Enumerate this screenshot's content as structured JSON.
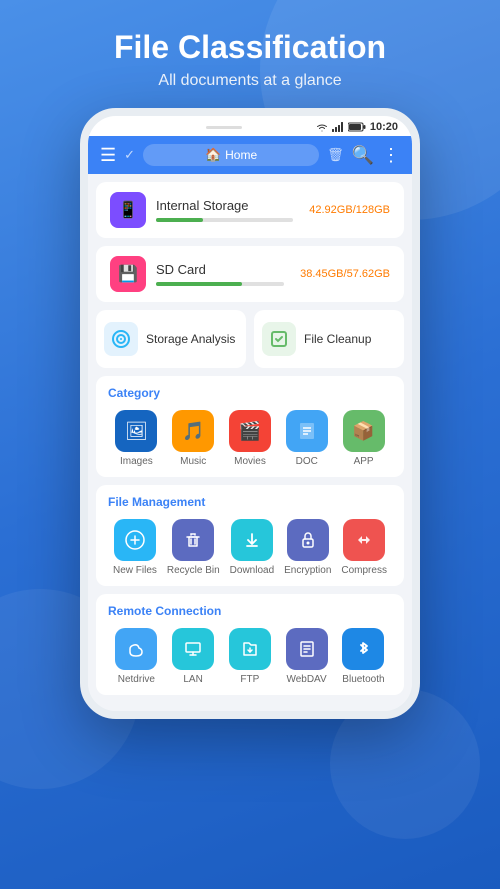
{
  "header": {
    "title": "File Classification",
    "subtitle": "All documents at a glance"
  },
  "status_bar": {
    "time": "10:20",
    "wifi_icon": "wifi",
    "signal_icon": "signal",
    "battery_icon": "battery"
  },
  "nav": {
    "home_label": "Home",
    "menu_icon": "☰",
    "check_icon": "✓",
    "search_icon": "🔍",
    "more_icon": "⋮",
    "home_icon": "🏠",
    "trash_icon": "🗑"
  },
  "storage": [
    {
      "name": "Internal Storage",
      "used": "42.92GB",
      "total": "128GB",
      "fill_percent": 34,
      "icon": "📱",
      "bg": "#7c4dff"
    },
    {
      "name": "SD Card",
      "used": "38.45GB",
      "total": "57.62GB",
      "fill_percent": 67,
      "icon": "💾",
      "bg": "#ff4081"
    }
  ],
  "quick_actions": [
    {
      "label": "Storage Analysis",
      "icon": "◎",
      "bg": "#e3f2fd",
      "color": "#29b6f6"
    },
    {
      "label": "File Cleanup",
      "icon": "⬜",
      "bg": "#e8f5e9",
      "color": "#66bb6a"
    }
  ],
  "category": {
    "title": "Category",
    "items": [
      {
        "label": "Images",
        "icon": "🖼",
        "bg": "#1565C0"
      },
      {
        "label": "Music",
        "icon": "🎵",
        "bg": "#FF9800"
      },
      {
        "label": "Movies",
        "icon": "🎬",
        "bg": "#F44336"
      },
      {
        "label": "DOC",
        "icon": "📄",
        "bg": "#42A5F5"
      },
      {
        "label": "APP",
        "icon": "📦",
        "bg": "#66BB6A"
      }
    ]
  },
  "file_management": {
    "title": "File Management",
    "items": [
      {
        "label": "New Files",
        "icon": "🕐",
        "bg": "#29B6F6"
      },
      {
        "label": "Recycle Bin",
        "icon": "🗑",
        "bg": "#5C6BC0"
      },
      {
        "label": "Download",
        "icon": "⬇",
        "bg": "#26C6DA"
      },
      {
        "label": "Encryption",
        "icon": "🔒",
        "bg": "#5C6BC0"
      },
      {
        "label": "Compress",
        "icon": "🔀",
        "bg": "#EF5350"
      }
    ]
  },
  "remote_connection": {
    "title": "Remote Connection",
    "items": [
      {
        "label": "Netdrive",
        "icon": "☁",
        "bg": "#42A5F5"
      },
      {
        "label": "LAN",
        "icon": "🖥",
        "bg": "#26C6DA"
      },
      {
        "label": "FTP",
        "icon": "📂",
        "bg": "#26C6DA"
      },
      {
        "label": "WebDAV",
        "icon": "📋",
        "bg": "#5C6BC0"
      },
      {
        "label": "Bluetooth",
        "icon": "🔵",
        "bg": "#1E88E5"
      }
    ]
  }
}
